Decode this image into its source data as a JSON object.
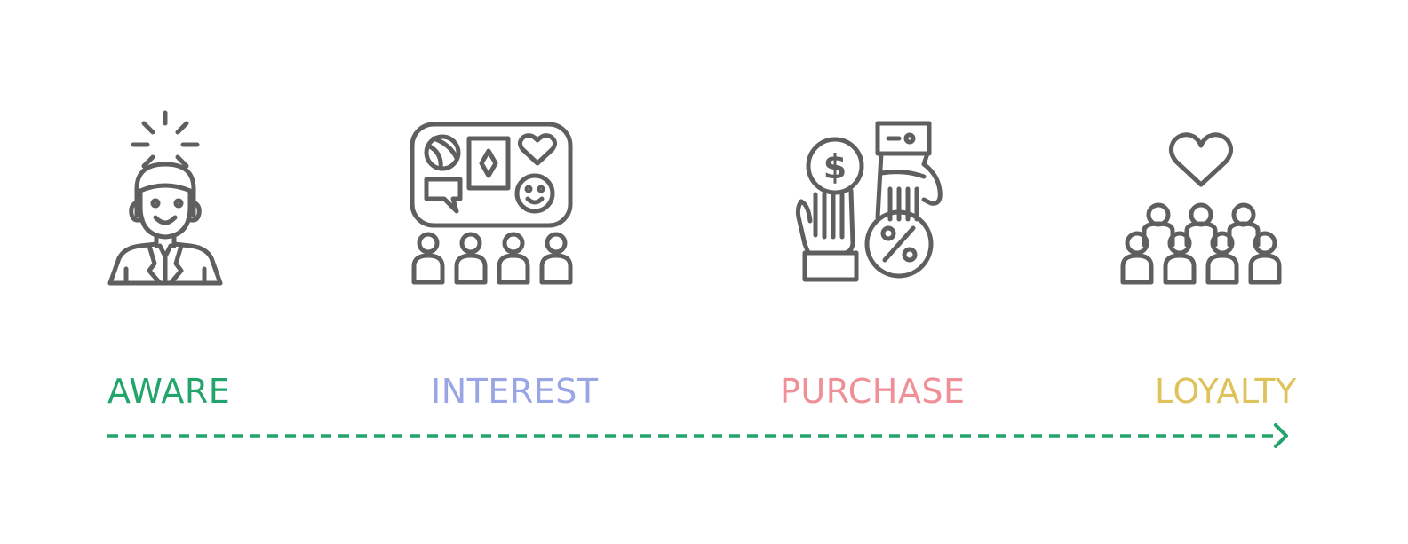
{
  "stages": [
    {
      "label": "AWARE",
      "color": "#22a46b",
      "icon": "aware-person-icon"
    },
    {
      "label": "INTEREST",
      "color": "#9aa5e6",
      "icon": "interest-board-audience-icon"
    },
    {
      "label": "PURCHASE",
      "color": "#ef8f98",
      "icon": "purchase-exchange-icon"
    },
    {
      "label": "LOYALTY",
      "color": "#ddc35a",
      "icon": "loyalty-heart-group-icon"
    }
  ],
  "timeline": {
    "color": "#22a46b",
    "style": "dashed-arrow"
  },
  "icon_color": "#5f5f5f"
}
